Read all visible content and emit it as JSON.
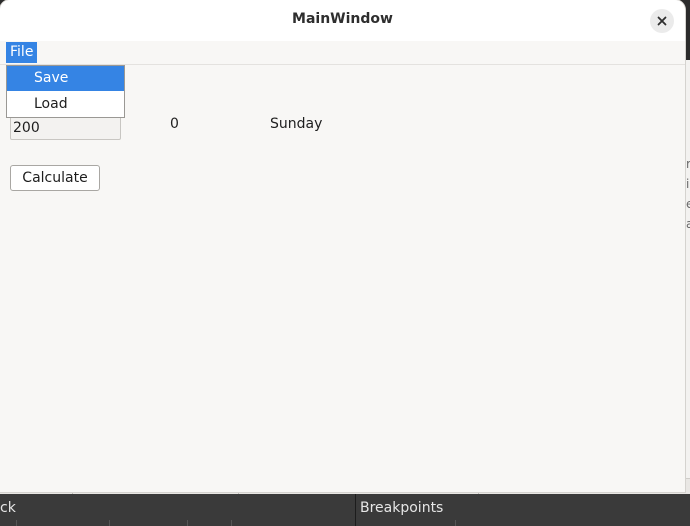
{
  "window": {
    "title": "MainWindow"
  },
  "menubar": {
    "file_label": "File"
  },
  "file_menu": {
    "items": [
      {
        "label": "Save",
        "selected": true
      },
      {
        "label": "Load",
        "selected": false
      }
    ]
  },
  "form": {
    "input_value": "200",
    "result_number": "0",
    "result_day": "Sunday",
    "calculate_label": "Calculate"
  },
  "background_ide": {
    "bottom_left_label": "ck",
    "bottom_right_label": "Breakpoints",
    "right_edge_letters": [
      "r",
      "i",
      "e",
      "a"
    ]
  },
  "colors": {
    "accent": "#3584e4",
    "window_bg": "#f8f7f5",
    "titlebar_bg": "#ffffff",
    "ide_panel_bg": "#3a3a3a"
  },
  "icons": {
    "close": "close-icon"
  }
}
